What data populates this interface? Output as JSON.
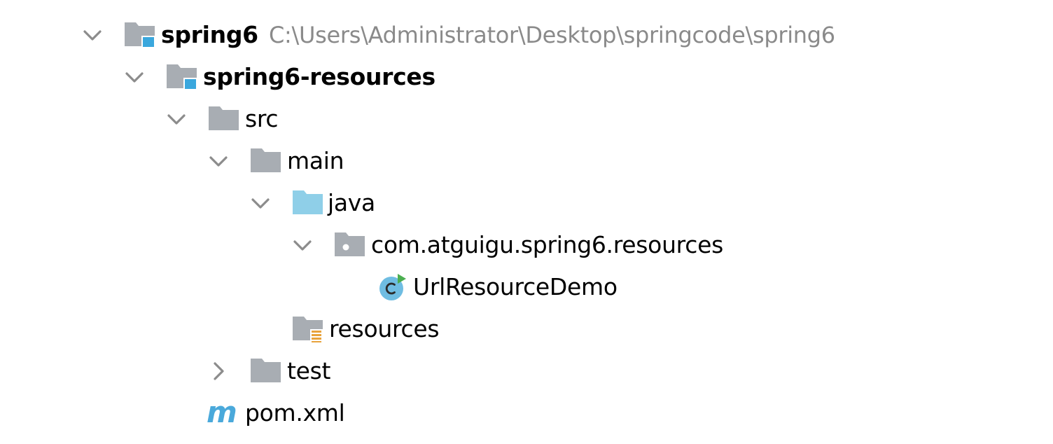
{
  "colors": {
    "folder": "#a8adb3",
    "module_badge": "#3aa7dd",
    "source_folder": "#8fcfe8",
    "class_icon": "#6fbde2",
    "run_marker": "#4caf50",
    "resources_marker": "#e8a33c",
    "maven": "#4aa9db",
    "path_text": "#8a8a8a",
    "arrow": "#8c8c8c"
  },
  "tree": {
    "project": {
      "name": "spring6",
      "path": "C:\\Users\\Administrator\\Desktop\\springcode\\spring6",
      "icon": "module-folder-icon"
    },
    "module": {
      "name": "spring6-resources",
      "icon": "module-folder-icon"
    },
    "src": {
      "name": "src",
      "icon": "folder-icon"
    },
    "main": {
      "name": "main",
      "icon": "folder-icon"
    },
    "java": {
      "name": "java",
      "icon": "source-folder-icon"
    },
    "package": {
      "name": "com.atguigu.spring6.resources",
      "icon": "package-icon"
    },
    "class": {
      "name": "UrlResourceDemo",
      "icon": "java-class-runnable-icon"
    },
    "resources": {
      "name": "resources",
      "icon": "resources-folder-icon"
    },
    "test": {
      "name": "test",
      "icon": "folder-icon"
    },
    "pom": {
      "name": "pom.xml",
      "icon": "maven-icon"
    }
  }
}
